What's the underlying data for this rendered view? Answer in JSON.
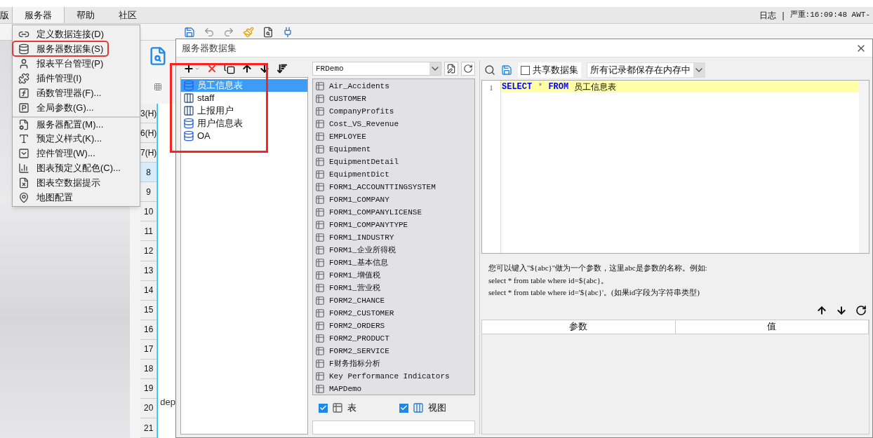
{
  "menubar": {
    "items": [
      {
        "label": "版",
        "selected": false
      },
      {
        "label": "服务器",
        "selected": true
      },
      {
        "label": "帮助",
        "selected": false
      },
      {
        "label": "社区",
        "selected": false
      }
    ]
  },
  "status": {
    "log": "日志",
    "separator": "|",
    "message": "严重:16:09:48 AWT-"
  },
  "row_headers": [
    {
      "label": "3(H)",
      "selected": false
    },
    {
      "label": "6(H)",
      "selected": false
    },
    {
      "label": "7(H)",
      "selected": false
    },
    {
      "label": "8",
      "selected": true
    },
    {
      "label": "9",
      "selected": false
    },
    {
      "label": "10",
      "selected": false
    },
    {
      "label": "11",
      "selected": false
    },
    {
      "label": "12",
      "selected": false
    },
    {
      "label": "13",
      "selected": false
    },
    {
      "label": "14",
      "selected": false
    },
    {
      "label": "15",
      "selected": false
    },
    {
      "label": "16",
      "selected": false
    },
    {
      "label": "17",
      "selected": false
    },
    {
      "label": "18",
      "selected": false
    },
    {
      "label": "19",
      "selected": false
    },
    {
      "label": "20",
      "selected": false
    },
    {
      "label": "21",
      "selected": false
    }
  ],
  "cell_text": "dep",
  "server_menu": {
    "items": [
      {
        "label": "定义数据连接(D)",
        "kind": "connection",
        "divider_before": false,
        "annotated": false
      },
      {
        "label": "服务器数据集(S)",
        "kind": "dataset",
        "divider_before": false,
        "annotated": true
      },
      {
        "label": "报表平台管理(P)",
        "kind": "user",
        "divider_before": false,
        "annotated": false
      },
      {
        "label": "插件管理(I)",
        "kind": "plugin",
        "divider_before": false,
        "annotated": false
      },
      {
        "label": "函数管理器(F)...",
        "kind": "function",
        "divider_before": false,
        "annotated": false
      },
      {
        "label": "全局参数(G)...",
        "kind": "parameter",
        "divider_before": false,
        "annotated": false
      },
      {
        "label": "服务器配置(M)...",
        "kind": "config",
        "divider_before": true,
        "annotated": false
      },
      {
        "label": "预定义样式(K)...",
        "kind": "style",
        "divider_before": false,
        "annotated": false
      },
      {
        "label": "控件管理(W)...",
        "kind": "widget",
        "divider_before": false,
        "annotated": false
      },
      {
        "label": "图表预定义配色(C)...",
        "kind": "chart",
        "divider_before": false,
        "annotated": false
      },
      {
        "label": "图表空数据提示",
        "kind": "empty",
        "divider_before": false,
        "annotated": false
      },
      {
        "label": "地图配置",
        "kind": "map",
        "divider_before": false,
        "annotated": false
      }
    ]
  },
  "dialog": {
    "title": "服务器数据集",
    "datasets": [
      {
        "name": "员工信息表",
        "kind": "query",
        "selected": true
      },
      {
        "name": "staff",
        "kind": "stored",
        "selected": false
      },
      {
        "name": "上报用户",
        "kind": "stored",
        "selected": false
      },
      {
        "name": "用户信息表",
        "kind": "query",
        "selected": false
      },
      {
        "name": "OA",
        "kind": "query",
        "selected": false
      }
    ],
    "datasets_annotated": true,
    "connection": "FRDemo",
    "tables": [
      "Air_Accidents",
      "CUSTOMER",
      "CompanyProfits",
      "Cost_VS_Revenue",
      "EMPLOYEE",
      "Equipment",
      "EquipmentDetail",
      "EquipmentDict",
      "FORM1_ACCOUNTTINGSYSTEM",
      "FORM1_COMPANY",
      "FORM1_COMPANYLICENSE",
      "FORM1_COMPANYTYPE",
      "FORM1_INDUSTRY",
      "FORM1_企业所得税",
      "FORM1_基本信息",
      "FORM1_增值税",
      "FORM1_营业税",
      "FORM2_CHANCE",
      "FORM2_CUSTOMER",
      "FORM2_ORDERS",
      "FORM2_PRODUCT",
      "FORM2_SERVICE",
      "F财务指标分析",
      "Key Performance Indicators",
      "MAPDemo"
    ],
    "filters": [
      {
        "label": "表",
        "checked": true,
        "kind": "table"
      },
      {
        "label": "视图",
        "checked": true,
        "kind": "view"
      }
    ],
    "share": {
      "label": "共享数据集",
      "checked": false
    },
    "cache_mode": "所有记录都保存在内存中",
    "sql": {
      "line_number": "1",
      "tokens": [
        {
          "text": "SELECT",
          "kind": "keyword"
        },
        {
          "text": "*",
          "kind": "operator"
        },
        {
          "text": "FROM",
          "kind": "keyword"
        },
        {
          "text": "员工信息表",
          "kind": "identifier"
        }
      ]
    },
    "help": [
      "您可以键入\"${abc}\"做为一个参数，这里abc是参数的名称。例如:",
      "select * from table where id=${abc}。",
      "select * from table where id='${abc}'。(如果id字段为字符串类型)"
    ],
    "param_columns": [
      "参数",
      "值"
    ]
  }
}
